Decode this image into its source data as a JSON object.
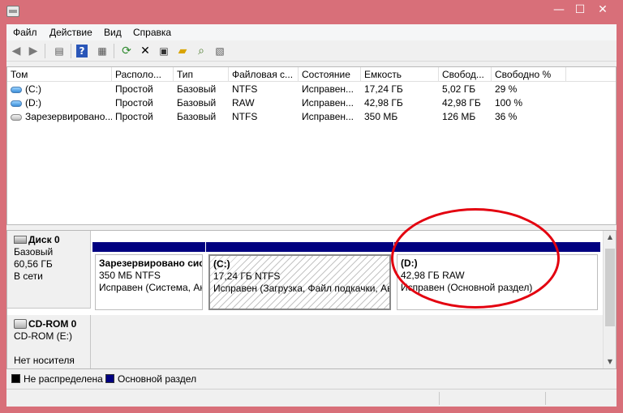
{
  "window": {
    "controls": {
      "minimize": "—",
      "maximize": "☐",
      "close": "✕"
    }
  },
  "menu": {
    "items": [
      "Файл",
      "Действие",
      "Вид",
      "Справка"
    ]
  },
  "toolbar": {
    "icons": [
      "back-icon",
      "forward-icon",
      "console-tree-icon",
      "help-icon",
      "properties-icon",
      "refresh-icon",
      "delete-icon",
      "settings-icon",
      "open-icon",
      "search-icon",
      "export-icon"
    ]
  },
  "volumes": {
    "columns": [
      "Том",
      "Располо...",
      "Тип",
      "Файловая с...",
      "Состояние",
      "Емкость",
      "Свобод...",
      "Свободно %"
    ],
    "rows": [
      {
        "name": "(C:)",
        "layout": "Простой",
        "type": "Базовый",
        "fs": "NTFS",
        "status": "Исправен...",
        "capacity": "17,24 ГБ",
        "free": "5,02 ГБ",
        "free_pct": "29 %"
      },
      {
        "name": "(D:)",
        "layout": "Простой",
        "type": "Базовый",
        "fs": "RAW",
        "status": "Исправен...",
        "capacity": "42,98 ГБ",
        "free": "42,98 ГБ",
        "free_pct": "100 %"
      },
      {
        "name": "Зарезервировано...",
        "layout": "Простой",
        "type": "Базовый",
        "fs": "NTFS",
        "status": "Исправен...",
        "capacity": "350 МБ",
        "free": "126 МБ",
        "free_pct": "36 %"
      }
    ]
  },
  "disks": {
    "disk0": {
      "title": "Диск 0",
      "type": "Базовый",
      "size": "60,56 ГБ",
      "status": "В сети",
      "partitions": [
        {
          "title": "Зарезервировано сис",
          "size": "350 МБ NTFS",
          "status": "Исправен (Система, Ак"
        },
        {
          "title": "(C:)",
          "size": "17,24 ГБ NTFS",
          "status": "Исправен (Загрузка, Файл подкачки, Ав"
        },
        {
          "title": "(D:)",
          "size": "42,98 ГБ RAW",
          "status": "Исправен (Основной раздел)"
        }
      ]
    },
    "cdrom0": {
      "title": "CD-ROM 0",
      "drive": "CD-ROM (E:)",
      "status": "Нет носителя"
    }
  },
  "legend": {
    "unallocated": {
      "label": "Не распределена",
      "color": "#000000"
    },
    "primary": {
      "label": "Основной раздел",
      "color": "#000080"
    }
  },
  "colors": {
    "title_bar": "#d86f79",
    "partition_bar": "#000080",
    "callout": "#e3000f"
  }
}
